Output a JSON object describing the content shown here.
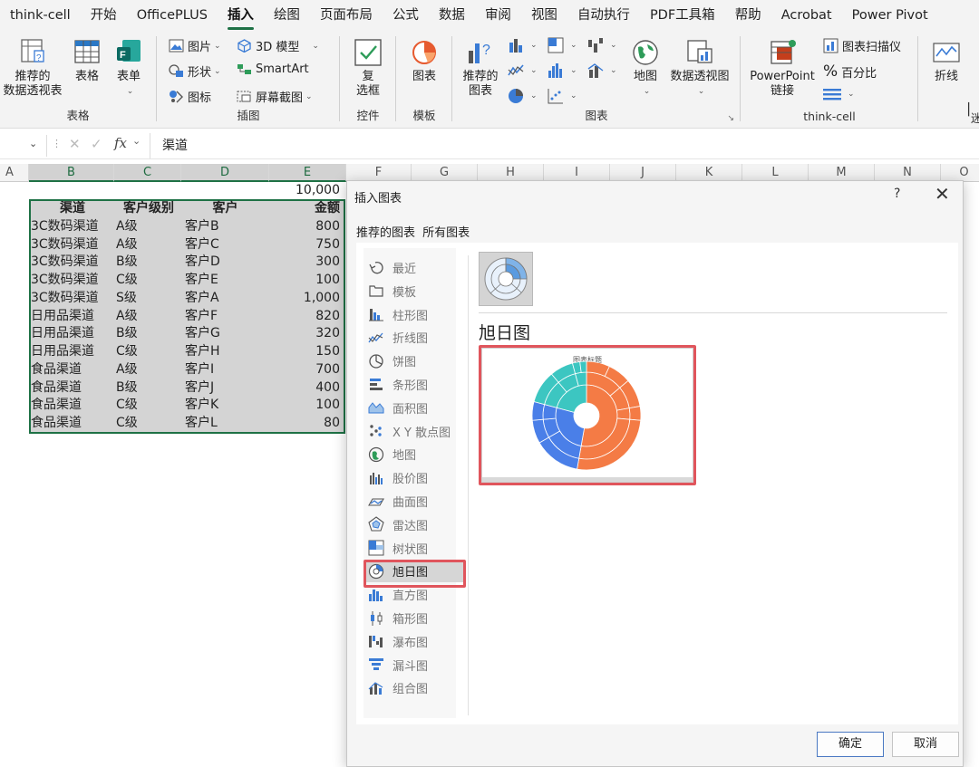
{
  "menu": [
    "think-cell",
    "开始",
    "OfficePLUS",
    "插入",
    "绘图",
    "页面布局",
    "公式",
    "数据",
    "审阅",
    "视图",
    "自动执行",
    "PDF工具箱",
    "帮助",
    "Acrobat",
    "Power Pivot"
  ],
  "ribbon": {
    "pivot_recommend": "推荐的\n数据透视表",
    "table": "表格",
    "form": "表单",
    "group_tables": "表格",
    "picture": "图片",
    "shapes": "形状",
    "icons": "图标",
    "model3d": "3D 模型",
    "smartart": "SmartArt",
    "screenshot": "屏幕截图",
    "group_illustrations": "插图",
    "checkbox": "复\n选框",
    "group_controls": "控件",
    "chart_template": "图表",
    "group_templates": "模板",
    "recommended_charts": "推荐的\n图表",
    "maps": "地图",
    "pivot_chart": "数据透视图",
    "group_charts": "图表",
    "ppt_link": "PowerPoint\n链接",
    "chart_scanner": "图表扫描仪",
    "percent": "百分比",
    "group_thinkcell": "think-cell",
    "sparkline": "折线",
    "cut_label": "迷"
  },
  "formula_bar": {
    "fx": "fx",
    "value": "渠道"
  },
  "columns": [
    "A",
    "B",
    "C",
    "D",
    "E",
    "F",
    "G",
    "H",
    "I",
    "J",
    "K",
    "L",
    "M",
    "N",
    "O"
  ],
  "sheet": {
    "e1": "10,000",
    "headers": [
      "渠道",
      "客户级别",
      "客户",
      "金额"
    ],
    "rows": [
      [
        "3C数码渠道",
        "A级",
        "客户B",
        "800"
      ],
      [
        "3C数码渠道",
        "A级",
        "客户C",
        "750"
      ],
      [
        "3C数码渠道",
        "B级",
        "客户D",
        "300"
      ],
      [
        "3C数码渠道",
        "C级",
        "客户E",
        "100"
      ],
      [
        "3C数码渠道",
        "S级",
        "客户A",
        "1,000"
      ],
      [
        "日用品渠道",
        "A级",
        "客户F",
        "820"
      ],
      [
        "日用品渠道",
        "B级",
        "客户G",
        "320"
      ],
      [
        "日用品渠道",
        "C级",
        "客户H",
        "150"
      ],
      [
        "食品渠道",
        "A级",
        "客户I",
        "700"
      ],
      [
        "食品渠道",
        "B级",
        "客户J",
        "400"
      ],
      [
        "食品渠道",
        "C级",
        "客户K",
        "100"
      ],
      [
        "食品渠道",
        "C级",
        "客户L",
        "80"
      ]
    ]
  },
  "dialog": {
    "title": "插入图表",
    "help": "?",
    "close": "✕",
    "tab_recommended": "推荐的图表",
    "tab_all": "所有图表",
    "chart_types": [
      "最近",
      "模板",
      "柱形图",
      "折线图",
      "饼图",
      "条形图",
      "面积图",
      "X Y 散点图",
      "地图",
      "股价图",
      "曲面图",
      "雷达图",
      "树状图",
      "旭日图",
      "直方图",
      "箱形图",
      "瀑布图",
      "漏斗图",
      "组合图"
    ],
    "selected_type": "旭日图",
    "subtype_title": "旭日图",
    "preview_title": "图表标题",
    "ok": "确定",
    "cancel": "取消",
    "colors": {
      "orange": "#f47b45",
      "blue": "#4a7fe8",
      "teal": "#3cc6c1",
      "highlight": "#e0555c"
    }
  }
}
